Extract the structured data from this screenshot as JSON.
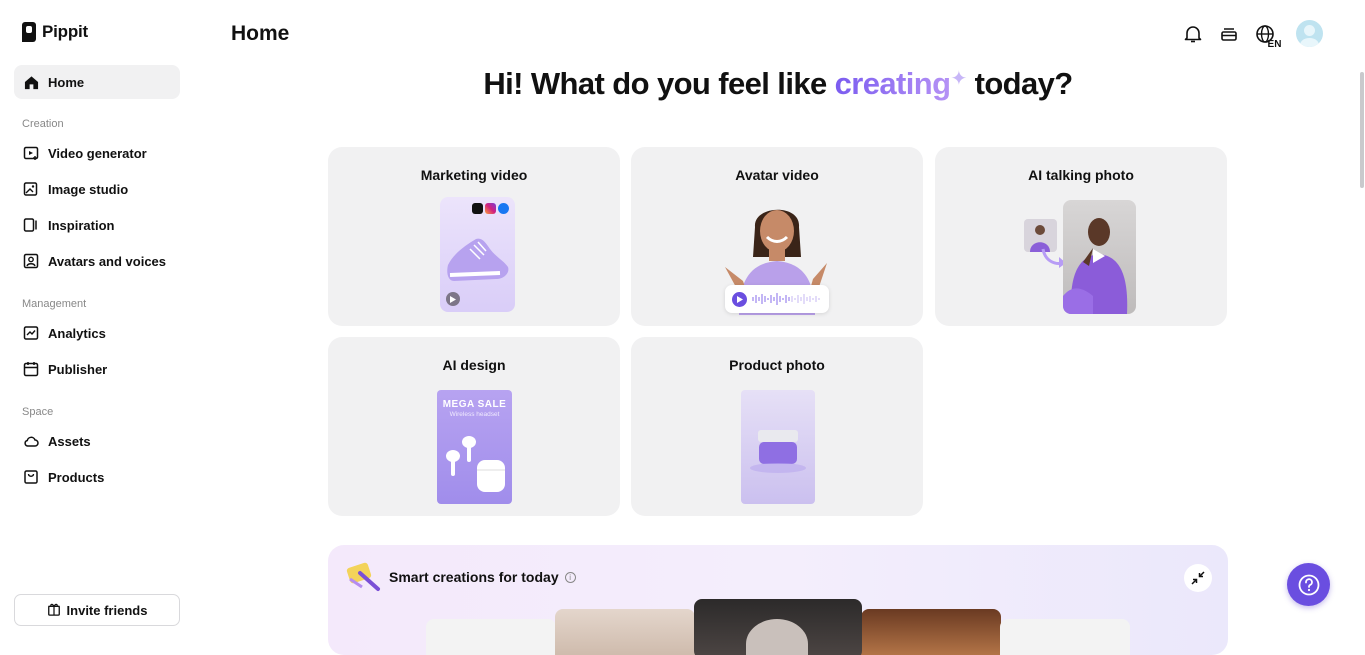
{
  "app": {
    "name": "Pippit"
  },
  "header": {
    "title": "Home",
    "lang": "EN"
  },
  "sidebar": {
    "home": "Home",
    "sections": {
      "creation": "Creation",
      "management": "Management",
      "space": "Space"
    },
    "creation_items": [
      "Video generator",
      "Image studio",
      "Inspiration",
      "Avatars and voices"
    ],
    "management_items": [
      "Analytics",
      "Publisher"
    ],
    "space_items": [
      "Assets",
      "Products"
    ],
    "invite": "Invite friends"
  },
  "hero": {
    "prefix": "Hi! What do you feel like ",
    "accent": "creating",
    "suffix": " today?"
  },
  "cards": [
    {
      "title": "Marketing video"
    },
    {
      "title": "Avatar video"
    },
    {
      "title": "AI talking photo"
    },
    {
      "title": "AI design",
      "thumb_line1": "MEGA SALE",
      "thumb_line2": "Wireless headset"
    },
    {
      "title": "Product photo"
    }
  ],
  "smart": {
    "title": "Smart creations for today",
    "info": "i"
  },
  "colors": {
    "accent": "#7b5cf0",
    "help_button": "#6a4ee0",
    "card_bg": "#f1f1f2"
  }
}
